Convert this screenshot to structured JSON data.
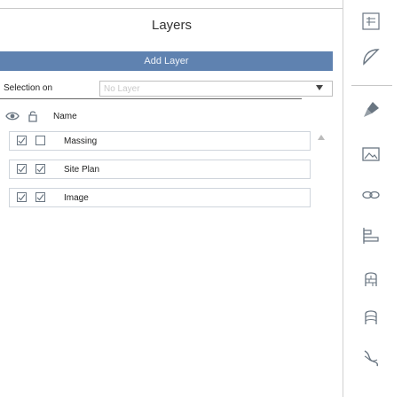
{
  "panel": {
    "title": "Layers",
    "add_layer_label": "Add Layer",
    "selection": {
      "label": "Selection on",
      "placeholder": "No Layer"
    },
    "header": {
      "name_label": "Name"
    },
    "layers": [
      {
        "name": "Massing",
        "visible": true,
        "locked": false
      },
      {
        "name": "Site Plan",
        "visible": true,
        "locked": true
      },
      {
        "name": "Image",
        "visible": true,
        "locked": true
      }
    ]
  },
  "toolbar": {
    "tools": [
      "window-restore-icon",
      "pen-tool-icon",
      "paint-brush-icon",
      "image-icon",
      "link-icon",
      "align-left-icon",
      "wall-icon",
      "building-icon",
      "curve-icon"
    ]
  },
  "colors": {
    "accent": "#5f82b0",
    "icon": "#6a7682",
    "border": "#cfd5dc"
  }
}
